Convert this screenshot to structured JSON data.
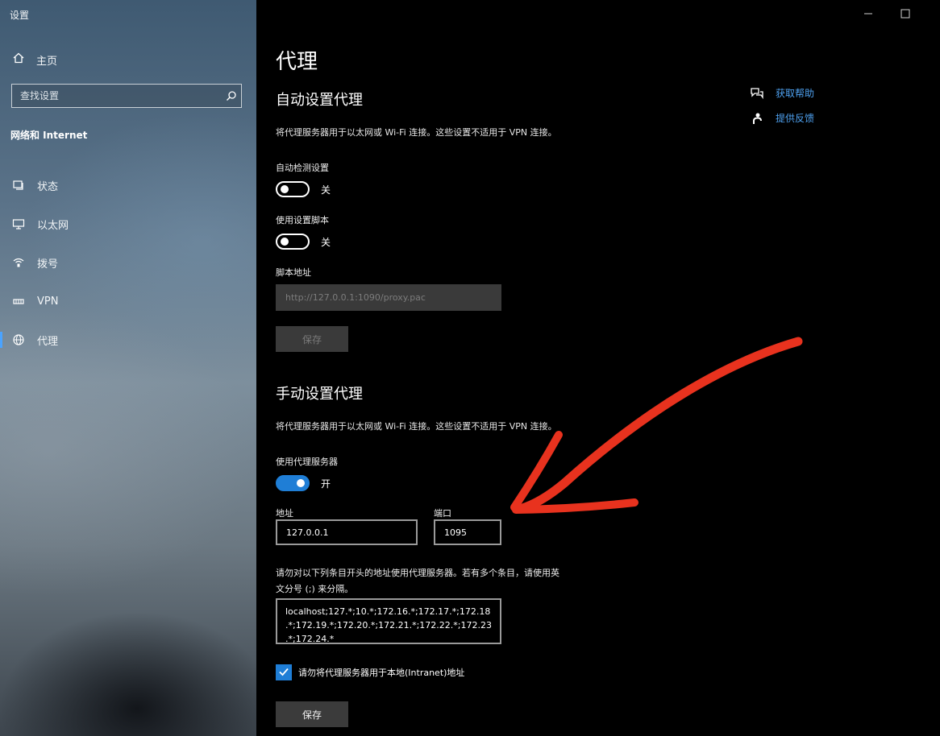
{
  "window": {
    "title": "设置",
    "controls": {
      "minimize_icon": "minimize-icon",
      "maximize_icon": "maximize-icon"
    }
  },
  "sidebar": {
    "home_label": "主页",
    "search_placeholder": "查找设置",
    "section_title": "网络和 Internet",
    "items": [
      {
        "label": "状态",
        "icon": "status-icon"
      },
      {
        "label": "以太网",
        "icon": "ethernet-icon"
      },
      {
        "label": "拨号",
        "icon": "dialup-icon"
      },
      {
        "label": "VPN",
        "icon": "vpn-icon"
      },
      {
        "label": "代理",
        "icon": "globe-icon",
        "active": true
      }
    ]
  },
  "main": {
    "title": "代理",
    "auto": {
      "heading": "自动设置代理",
      "description": "将代理服务器用于以太网或 Wi-Fi 连接。这些设置不适用于 VPN 连接。",
      "detect_label": "自动检测设置",
      "detect_state": "关",
      "script_label": "使用设置脚本",
      "script_state": "关",
      "script_address_label": "脚本地址",
      "script_address_value": "http://127.0.0.1:1090/proxy.pac",
      "save_label": "保存"
    },
    "manual": {
      "heading": "手动设置代理",
      "description": "将代理服务器用于以太网或 Wi-Fi 连接。这些设置不适用于 VPN 连接。",
      "use_proxy_label": "使用代理服务器",
      "use_proxy_state": "开",
      "address_label": "地址",
      "address_value": "127.0.0.1",
      "port_label": "端口",
      "port_value": "1095",
      "exceptions_label_line1": "请勿对以下列条目开头的地址使用代理服务器。若有多个条目，请使用英",
      "exceptions_label_line2": "文分号 (;) 来分隔。",
      "exceptions_value": "localhost;127.*;10.*;172.16.*;172.17.*;172.18.*;172.19.*;172.20.*;172.21.*;172.22.*;172.23.*;172.24.*",
      "local_bypass_label": "请勿将代理服务器用于本地(Intranet)地址",
      "local_bypass_checked": true,
      "save_label": "保存"
    },
    "links": [
      {
        "label": "获取帮助",
        "icon": "help-chat-icon"
      },
      {
        "label": "提供反馈",
        "icon": "feedback-icon"
      }
    ]
  },
  "colors": {
    "accent": "#1f7ed6",
    "link": "#4ea1f0",
    "annotation_arrow": "#e8321e"
  }
}
